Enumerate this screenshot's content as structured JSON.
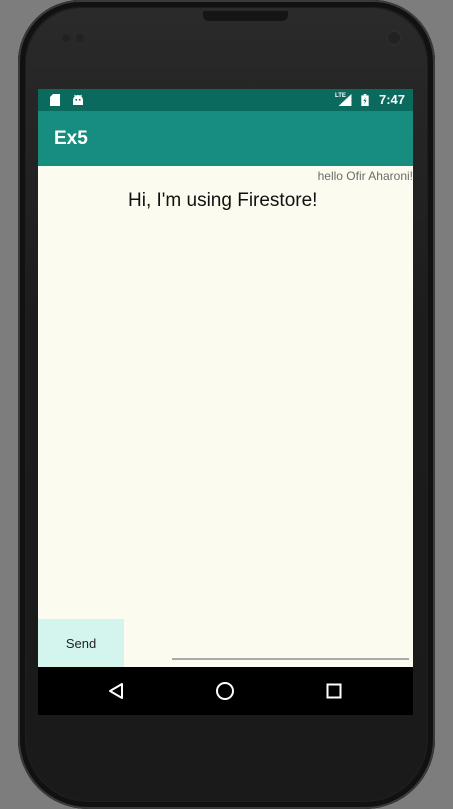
{
  "status_bar": {
    "time": "7:47",
    "network_label": "LTE",
    "icons": [
      "sd-card-icon",
      "android-icon",
      "signal-icon",
      "battery-icon"
    ]
  },
  "app_bar": {
    "title": "Ex5"
  },
  "main": {
    "greeting": "hello Ofir Aharoni!",
    "message": "Hi, I'm using Firestore!"
  },
  "composer": {
    "send_label": "Send",
    "input_value": "",
    "input_placeholder": ""
  },
  "nav_bar": {
    "buttons": [
      "back-icon",
      "home-icon",
      "recents-icon"
    ]
  },
  "colors": {
    "status_bar": "#0b6a5e",
    "app_bar": "#178d80",
    "background": "#fbfbef",
    "send_button": "#d3f5ee"
  }
}
